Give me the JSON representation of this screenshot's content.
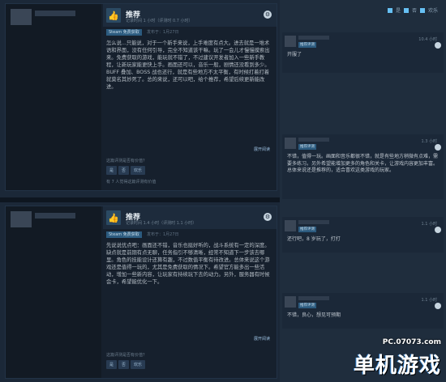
{
  "reviews": [
    {
      "recommendation": "推荐",
      "hours": "记录时间 1 小时（评测时 0.7 小时）",
      "badge": "Steam 免费获取",
      "posted": "发布于：1月27日",
      "body": "怎么说...只能说，对于一个新手来说，上手难度有点大。进去就是一堆术语和界面，没有任何引导，完全不知道该干嘛。玩了一会儿才慢慢摸索出来。免费获取的游戏，能玩就不错了，不过建议开发者加入一些新手教程，让新玩家能更快上手。画面还可以，音乐一般，剧情还没看到多少。BUFF 叠加、BOSS 战也还行，就是有些地方不太平衡，有时候打着打着就莫名其妙死了。总的来说，还可以吧，给个推荐，希望后续更新能改进。",
      "read_more": "展开阅读",
      "helpful_question": "这篇评测是否有价值？",
      "votes": [
        "是",
        "否",
        "欢乐"
      ],
      "helpful_count": "有 7 人觉得这篇评测有价值"
    },
    {
      "recommendation": "推荐",
      "hours": "记录时间 1.4 小时（评测时 1.1 小时）",
      "badge": "Steam 免费获取",
      "posted": "发布于：1月27日",
      "body": "先说说优点吧：画面还不错，音乐也挺好听的，战斗系统有一定的深度。缺点就是前期有点无聊，任务指引不够清晰，经常不知道下一步该去哪里。角色的技能设计还算有趣，不过数值平衡有待改进。总体来说这个游戏还是值得一玩的，尤其是免费获取的情况下。希望官方能多出一些活动，增加一些新内容，让玩家有持续玩下去的动力。另外，服务器有时候会卡，希望能优化一下。",
      "read_more": "展开阅读",
      "helpful_question": "这篇评测是否有价值？",
      "votes": [
        "是",
        "否",
        "欢乐"
      ]
    }
  ],
  "top_icons": {
    "yes": "是",
    "no": "否",
    "funny": "欢乐"
  },
  "comments": [
    {
      "badge": "推荐评测",
      "hours": "10.4 小时",
      "body": "开服了"
    },
    {
      "badge": "推荐评测",
      "hours": "1.3 小时",
      "body": "不错，值得一玩。画面和音乐都很不错，就是有些地方稍微有点难，需要多练习。另外希望能增加更多的角色和关卡，让游戏内容更加丰富。总体来说还是推荐的，适合喜欢这类游戏的玩家。"
    },
    {
      "badge": "推荐评测",
      "hours": "1.1 小时",
      "body": "还行吧，8 岁玩了，打打"
    },
    {
      "badge": "推荐评测",
      "hours": "1.1 小时",
      "body": "不错，良心，想见可预期"
    }
  ],
  "watermark": {
    "site": "PC.07073.com",
    "logo": "单机游戏"
  }
}
